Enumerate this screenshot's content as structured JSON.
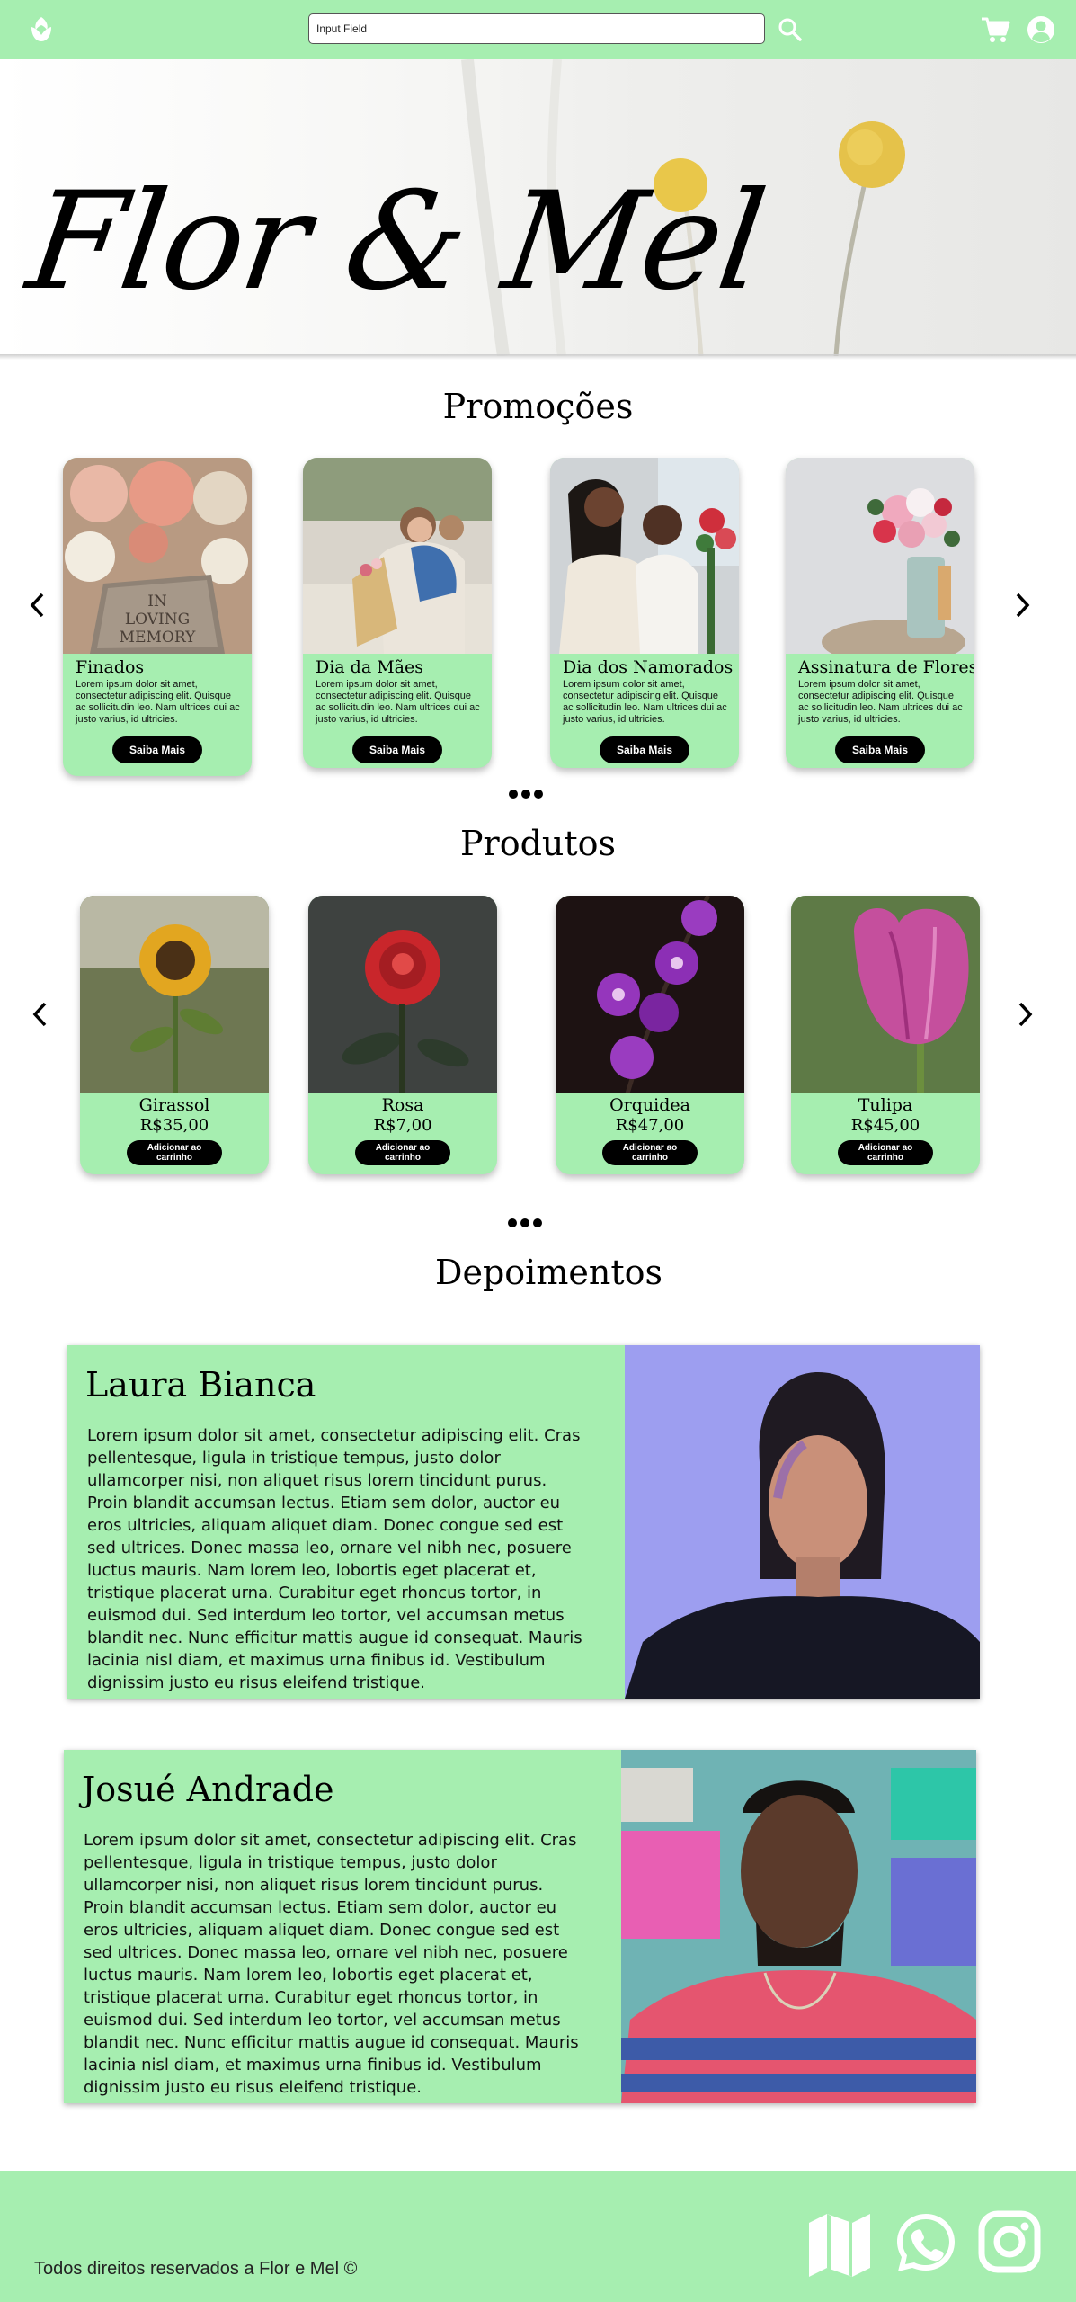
{
  "header": {
    "search_placeholder": "Input Field",
    "icons": [
      "flower-logo-icon",
      "search-icon",
      "cart-icon",
      "user-icon"
    ]
  },
  "hero": {
    "title": "Flor & Mel"
  },
  "promocoes": {
    "title": "Promoções",
    "cards": [
      {
        "name": "Finados",
        "text": "Lorem ipsum dolor sit amet, consectetur adipiscing elit. Quisque ac sollicitudin leo. Nam ultrices dui ac justo varius, id ultricies.",
        "button": "Saiba Mais"
      },
      {
        "name": "Dia da Mães",
        "text": "Lorem ipsum dolor sit amet, consectetur adipiscing elit. Quisque ac sollicitudin leo. Nam ultrices dui ac justo varius, id ultricies.",
        "button": "Saiba Mais"
      },
      {
        "name": "Dia dos Namorados",
        "text": "Lorem ipsum dolor sit amet, consectetur adipiscing elit. Quisque ac sollicitudin leo. Nam ultrices dui ac justo varius, id ultricies.",
        "button": "Saiba Mais"
      },
      {
        "name": "Assinatura de Flores",
        "text": "Lorem ipsum dolor sit amet, consectetur adipiscing elit. Quisque ac sollicitudin leo. Nam ultrices dui ac justo varius, id ultricies.",
        "button": "Saiba Mais"
      }
    ]
  },
  "produtos": {
    "title": "Produtos",
    "items": [
      {
        "name": "Girassol",
        "price": "R$35,00",
        "button": "Adicionar ao carrinho"
      },
      {
        "name": "Rosa",
        "price": "R$7,00",
        "button": "Adicionar ao carrinho"
      },
      {
        "name": "Orquidea",
        "price": "R$47,00",
        "button": "Adicionar ao carrinho"
      },
      {
        "name": "Tulipa",
        "price": "R$45,00",
        "button": "Adicionar ao carrinho"
      }
    ]
  },
  "depoimentos": {
    "title": "Depoimentos",
    "items": [
      {
        "name": "Laura Bianca",
        "text": "Lorem ipsum dolor sit amet, consectetur adipiscing elit. Cras pellentesque, ligula in tristique tempus, justo dolor ullamcorper nisi, non aliquet risus lorem tincidunt purus. Proin blandit accumsan lectus. Etiam sem dolor, auctor eu eros ultricies, aliquam aliquet diam. Donec congue sed est sed ultrices. Donec massa leo, ornare vel nibh nec, posuere luctus mauris. Nam lorem leo, lobortis eget placerat et, tristique placerat urna. Curabitur eget rhoncus tortor, in euismod dui. Sed interdum leo tortor, vel accumsan metus blandit nec. Nunc efficitur mattis augue id consequat. Mauris lacinia nisl diam, et maximus urna finibus id. Vestibulum dignissim justo eu risus eleifend tristique."
      },
      {
        "name": "Josué Andrade",
        "text": "Lorem ipsum dolor sit amet, consectetur adipiscing elit. Cras pellentesque, ligula in tristique tempus, justo dolor ullamcorper nisi, non aliquet risus lorem tincidunt purus. Proin blandit accumsan lectus. Etiam sem dolor, auctor eu eros ultricies, aliquam aliquet diam. Donec congue sed est sed ultrices. Donec massa leo, ornare vel nibh nec, posuere luctus mauris. Nam lorem leo, lobortis eget placerat et, tristique placerat urna. Curabitur eget rhoncus tortor, in euismod dui. Sed interdum leo tortor, vel accumsan metus blandit nec. Nunc efficitur mattis augue id consequat. Mauris lacinia nisl diam, et maximus urna finibus id. Vestibulum dignissim justo eu risus eleifend tristique."
      }
    ]
  },
  "footer": {
    "copyright": "Todos direitos reservados a Flor e Mel ©",
    "icons": [
      "map-icon",
      "whatsapp-icon",
      "instagram-icon"
    ]
  },
  "colors": {
    "accent": "#a6eeb0",
    "button": "#000000",
    "text": "#000000"
  }
}
